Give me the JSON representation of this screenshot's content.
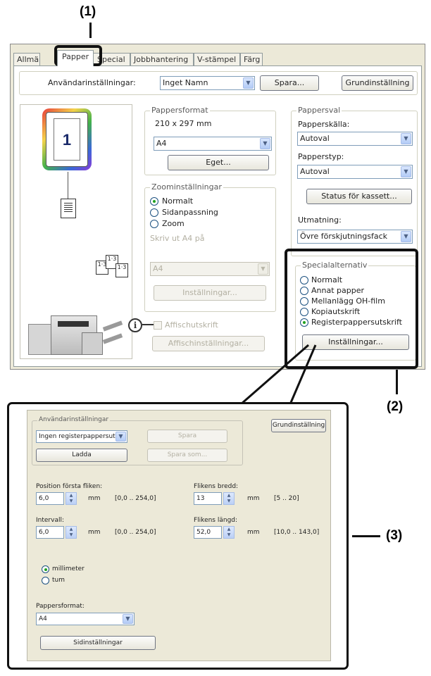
{
  "callouts": {
    "one": "(1)",
    "two": "(2)",
    "three": "(3)"
  },
  "tabs": [
    {
      "label": "Allmänt"
    },
    {
      "label": "Papper"
    },
    {
      "label": "Special"
    },
    {
      "label": "Jobbhantering"
    },
    {
      "label": "V-stämpel"
    },
    {
      "label": "Färg"
    }
  ],
  "user_settings": {
    "label": "Användarinställningar:",
    "value": "Inget Namn",
    "save": "Spara...",
    "default": "Grundinställning"
  },
  "preview": {
    "page_number": "1"
  },
  "paper_format": {
    "title": "Pappersformat",
    "size_text": "210 x 297 mm",
    "value": "A4",
    "custom_button": "Eget..."
  },
  "zoom": {
    "title": "Zoominställningar",
    "options": [
      "Normalt",
      "Sidanpassning",
      "Zoom"
    ],
    "selected": "Normalt",
    "fit_label": "Skriv ut A4 på",
    "fit_value": "A4",
    "settings_button": "Inställningar..."
  },
  "poster": {
    "checkbox_label": "Affischutskrift",
    "settings_button": "Affischinställningar..."
  },
  "paper_select": {
    "title": "Pappersval",
    "source_label": "Papperskälla:",
    "source_value": "Autoval",
    "type_label": "Papperstyp:",
    "type_value": "Autoval",
    "status_button": "Status för kassett...",
    "output_label": "Utmatning:",
    "output_value": "Övre förskjutningsfack"
  },
  "special_options": {
    "title": "Specialalternativ",
    "options": [
      "Normalt",
      "Annat papper",
      "Mellanlägg OH-film",
      "Kopiautskrift",
      "Registerpappersutskrift"
    ],
    "selected": "Registerpappersutskrift",
    "settings_button": "Inställningar..."
  },
  "tab_dialog": {
    "user_settings_title": "Användarinställningar",
    "user_settings_value": "Ingen registerpappersutsk",
    "save": "Spara",
    "load": "Ladda",
    "save_as": "Spara som...",
    "default": "Grundinställning",
    "first_tab_pos_label": "Position första fliken:",
    "first_tab_pos_value": "6,0",
    "first_tab_pos_range": "[0,0 .. 254,0]",
    "tab_width_label": "Flikens bredd:",
    "tab_width_value": "13",
    "tab_width_range": "[5 .. 20]",
    "interval_label": "Intervall:",
    "interval_value": "6,0",
    "interval_range": "[0,0 .. 254,0]",
    "tab_length_label": "Flikens längd:",
    "tab_length_value": "52,0",
    "tab_length_range": "[10,0 .. 143,0]",
    "unit": "mm",
    "unit_options": [
      "millimeter",
      "tum"
    ],
    "unit_selected": "millimeter",
    "paper_format_label": "Pappersformat:",
    "paper_format_value": "A4",
    "page_settings_button": "Sidinställningar"
  }
}
